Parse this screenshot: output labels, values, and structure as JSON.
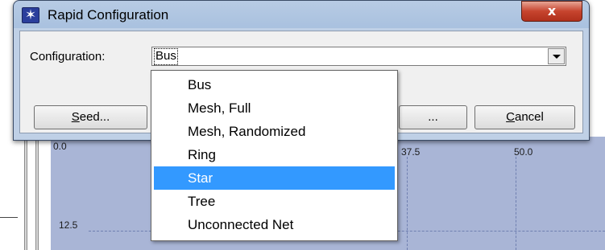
{
  "window": {
    "title": "Rapid Configuration",
    "close_glyph": "x"
  },
  "config": {
    "label": "Configuration:",
    "value": "Bus"
  },
  "buttons": {
    "seed": "Seed...",
    "partial": "...",
    "cancel": "Cancel"
  },
  "dropdown": {
    "options": [
      "Bus",
      "Mesh, Full",
      "Mesh, Randomized",
      "Ring",
      "Star",
      "Tree",
      "Unconnected Net"
    ],
    "highlighted": "Star"
  },
  "background_grid": {
    "labels": [
      "0.0",
      "37.5",
      "50.0",
      "12.5"
    ]
  },
  "colors": {
    "highlight": "#3399ff",
    "canvas": "#a9b5d6",
    "close_button": "#c7442e",
    "title_icon": "#2a3e9c"
  },
  "icons": [
    "app-star-icon",
    "close-icon",
    "chevron-down-icon"
  ]
}
